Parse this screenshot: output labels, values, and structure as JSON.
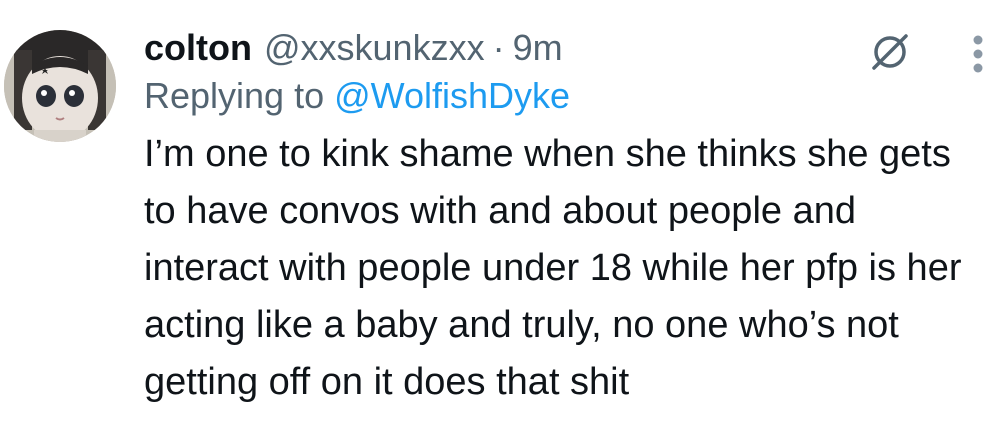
{
  "tweet": {
    "display_name": "colton",
    "handle": "@xxskunkzxx",
    "separator": "·",
    "time": "9m",
    "replying_prefix": "Replying to ",
    "replying_to": "@WolfishDyke",
    "text": "I’m one to kink shame when she thinks she gets to have convos with and about people and interact with people under 18 while her pfp is her acting like a baby and truly, no one who’s not getting off on it does that shit"
  },
  "icons": {
    "avatar": "user-avatar",
    "grok": "grok-slash-icon",
    "more": "more-options-icon"
  },
  "colors": {
    "primary_text": "#0f1419",
    "secondary_text": "#536471",
    "link": "#1d9bf0"
  }
}
